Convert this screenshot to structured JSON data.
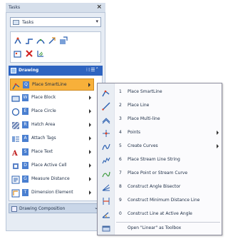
{
  "panel": {
    "title": "Tasks",
    "close_glyph": "×"
  },
  "combo": {
    "value": "Tasks",
    "icon": "tasks-icon"
  },
  "toolbox_icons": [
    "line-icon",
    "curve-icon",
    "arc-icon",
    "dimension-icon",
    "cell-icon",
    "fence-icon",
    "delete-icon",
    "pattern-icon"
  ],
  "drawing_group": {
    "label": "Drawing"
  },
  "drawing_tools": [
    {
      "key": "Q",
      "label": "Place SmartLine",
      "icon": "smartline-icon",
      "selected": true,
      "submenu": true
    },
    {
      "key": "W",
      "label": "Place Block",
      "icon": "block-icon",
      "submenu": true
    },
    {
      "key": "E",
      "label": "Place Circle",
      "icon": "circle-icon",
      "submenu": true
    },
    {
      "key": "R",
      "label": "Hatch Area",
      "icon": "hatch-icon",
      "submenu": true
    },
    {
      "key": "A",
      "label": "Attach Tags",
      "icon": "tags-icon",
      "submenu": true
    },
    {
      "key": "S",
      "label": "Place Text",
      "icon": "text-icon",
      "submenu": true
    },
    {
      "key": "D",
      "label": "Place Active Cell",
      "icon": "cell-icon",
      "submenu": true
    },
    {
      "key": "G",
      "label": "Measure Distance",
      "icon": "measure-icon",
      "submenu": true
    },
    {
      "key": "T",
      "label": "Dimension Element",
      "icon": "dimension-icon",
      "submenu": true
    }
  ],
  "composition_group": {
    "label": "Drawing Composition"
  },
  "flyout": [
    {
      "num": "1",
      "label": "Place SmartLine",
      "icon": "smartline-icon"
    },
    {
      "num": "2",
      "label": "Place Line",
      "icon": "line-icon"
    },
    {
      "num": "3",
      "label": "Place Multi-line",
      "icon": "multiline-icon"
    },
    {
      "num": "4",
      "label": "Points",
      "icon": "points-icon",
      "submenu": true
    },
    {
      "num": "5",
      "label": "Create Curves",
      "icon": "curves-icon",
      "submenu": true
    },
    {
      "num": "6",
      "label": "Place Stream Line String",
      "icon": "stream-icon"
    },
    {
      "num": "7",
      "label": "Place Point or Stream Curve",
      "icon": "stream-curve-icon"
    },
    {
      "num": "8",
      "label": "Construct Angle Bisector",
      "icon": "bisector-icon"
    },
    {
      "num": "9",
      "label": "Construct Minimum Distance Line",
      "icon": "min-distance-icon"
    },
    {
      "num": "0",
      "label": "Construct Line at Active Angle",
      "icon": "active-angle-icon"
    }
  ],
  "open_toolbox": "Open \"Linear\" as Toolbox",
  "colors": {
    "accent": "#2e64c0",
    "selected": "#f7b03a",
    "panel": "#e6ecf4"
  }
}
